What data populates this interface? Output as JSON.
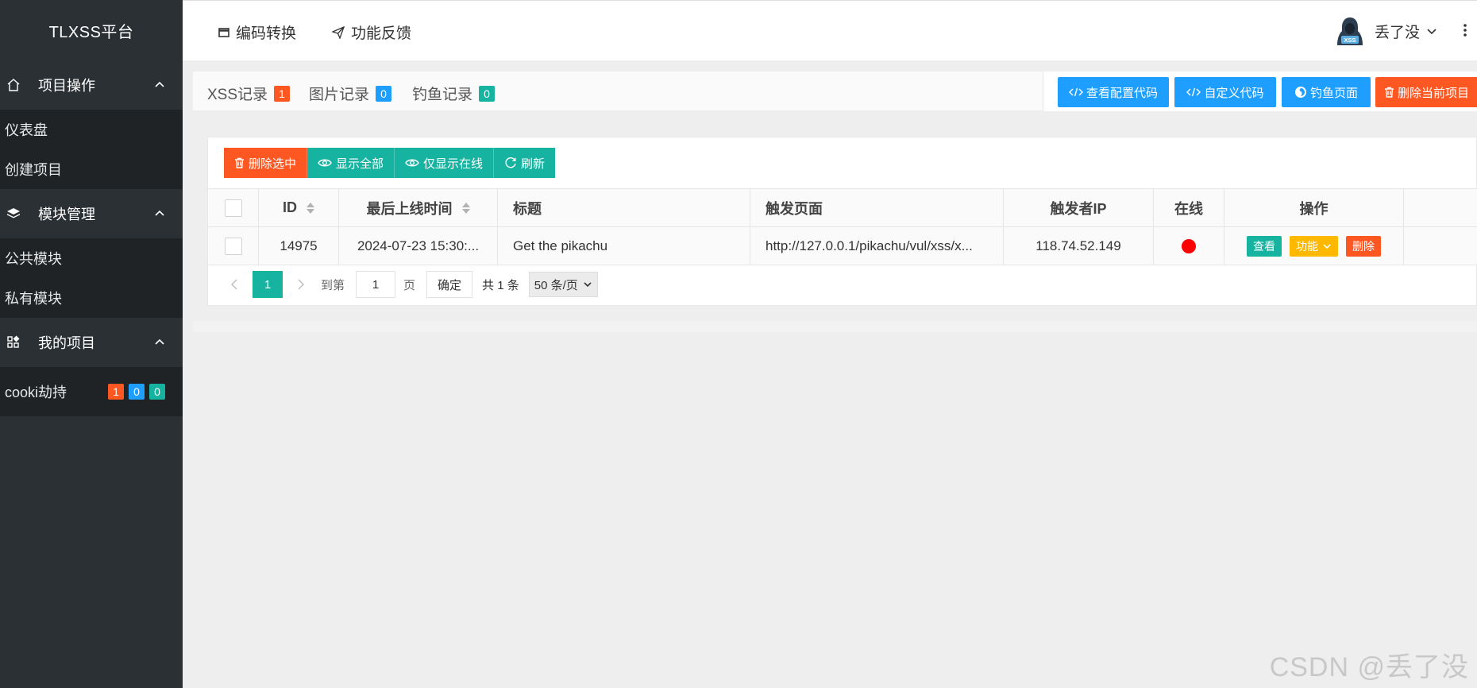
{
  "sidebar": {
    "logo": "TLXSS平台",
    "groups": [
      {
        "label": "项目操作",
        "icon": "home-icon"
      },
      {
        "label": "模块管理",
        "icon": "layers-icon"
      },
      {
        "label": "我的项目",
        "icon": "apps-icon"
      }
    ],
    "project_ops": [
      "仪表盘",
      "创建项目"
    ],
    "modules": [
      "公共模块",
      "私有模块"
    ],
    "my_projects": [
      {
        "label": "cooki劫持",
        "counts": [
          "1",
          "0",
          "0"
        ]
      }
    ]
  },
  "header": {
    "links": [
      {
        "label": "编码转换",
        "icon": "window-icon"
      },
      {
        "label": "功能反馈",
        "icon": "send-icon"
      }
    ],
    "user": {
      "name": "丢了没",
      "avatar_text": "XSS"
    }
  },
  "tabs": [
    {
      "label": "XSS记录",
      "count": "1",
      "color": "#ff5722"
    },
    {
      "label": "图片记录",
      "count": "0",
      "color": "#1e9fff"
    },
    {
      "label": "钓鱼记录",
      "count": "0",
      "color": "#16b3a1"
    }
  ],
  "tab_buttons": [
    {
      "label": "查看配置代码",
      "color": "#1e9fff",
      "icon": "code-icon"
    },
    {
      "label": "自定义代码",
      "color": "#1e9fff",
      "icon": "code-icon"
    },
    {
      "label": "钓鱼页面",
      "color": "#1e9fff",
      "icon": "firefox-icon"
    },
    {
      "label": "删除当前项目",
      "color": "#ff5722",
      "icon": "trash-icon"
    }
  ],
  "toolbar": [
    {
      "label": "删除选中",
      "color": "#ff5722",
      "icon": "trash-icon"
    },
    {
      "label": "显示全部",
      "color": "#16b3a1",
      "icon": "eye-icon"
    },
    {
      "label": "仅显示在线",
      "color": "#16b3a1",
      "icon": "eye-icon"
    },
    {
      "label": "刷新",
      "color": "#16b3a1",
      "icon": "refresh-icon"
    }
  ],
  "table": {
    "columns": [
      "ID",
      "最后上线时间",
      "标题",
      "触发页面",
      "触发者IP",
      "在线",
      "操作"
    ],
    "rows": [
      {
        "id": "14975",
        "time": "2024-07-23 15:30:...",
        "title": "Get the pikachu",
        "page": "http://127.0.0.1/pikachu/vul/xss/x...",
        "ip": "118.74.52.149",
        "online": true,
        "actions": {
          "view": "查看",
          "func": "功能",
          "del": "删除"
        }
      }
    ]
  },
  "pager": {
    "current": "1",
    "goto_label": "到第",
    "goto_value": "1",
    "page_suffix": "页",
    "confirm": "确定",
    "total": "共 1 条",
    "per_page": "50 条/页"
  },
  "watermark": "CSDN @丢了没"
}
